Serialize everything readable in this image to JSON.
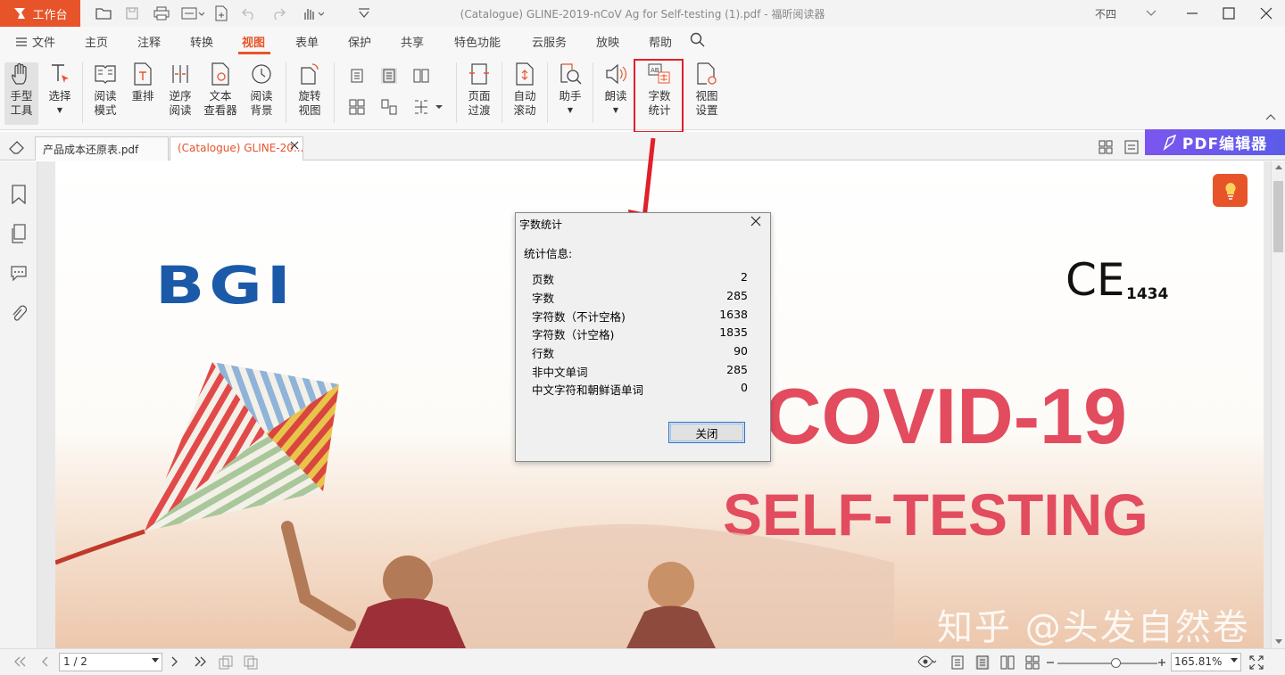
{
  "titlebar": {
    "workbench_label": "工作台",
    "doc_title": "(Catalogue) GLINE-2019-nCoV Ag for Self-testing (1).pdf - 福昕阅读器",
    "user_name": "不四"
  },
  "menu": {
    "file_label": "文件",
    "items": [
      "主页",
      "注释",
      "转换",
      "视图",
      "表单",
      "保护",
      "共享",
      "特色功能",
      "云服务",
      "放映",
      "帮助"
    ],
    "active": "视图"
  },
  "ribbon": {
    "hand": [
      "手型",
      "工具"
    ],
    "select": "选择",
    "read_mode": [
      "阅读",
      "模式"
    ],
    "reflow": "重排",
    "reverse_read": [
      "逆序",
      "阅读"
    ],
    "text_viewer": [
      "文本",
      "查看器"
    ],
    "read_bg": [
      "阅读",
      "背景"
    ],
    "rotate_view": [
      "旋转",
      "视图"
    ],
    "page_transition": [
      "页面",
      "过渡"
    ],
    "auto_scroll": [
      "自动",
      "滚动"
    ],
    "assistant": "助手",
    "read_aloud": "朗读",
    "word_count": [
      "字数",
      "统计"
    ],
    "view_settings": [
      "视图",
      "设置"
    ]
  },
  "tabs": [
    {
      "label": "产品成本还原表.pdf"
    },
    {
      "label": "(Catalogue) GLINE-20..."
    }
  ],
  "pdf_editor_label": "PDF编辑器",
  "document": {
    "logo_text": "BGI",
    "ce_mark": "CE",
    "ce_number": "1434",
    "headline1": "COVID-19",
    "headline2": "SELF-TESTING",
    "watermark": "知乎 @头发自然卷"
  },
  "dialog": {
    "title": "字数统计",
    "heading": "统计信息:",
    "rows": [
      {
        "label": "页数",
        "value": "2"
      },
      {
        "label": "字数",
        "value": "285"
      },
      {
        "label": "字符数（不计空格)",
        "value": "1638"
      },
      {
        "label": "字符数（计空格)",
        "value": "1835"
      },
      {
        "label": "行数",
        "value": "90"
      },
      {
        "label": "非中文单词",
        "value": "285"
      },
      {
        "label": "中文字符和朝鲜语单词",
        "value": "0"
      }
    ],
    "close_label": "关闭"
  },
  "statusbar": {
    "page": "1 / 2",
    "zoom": "165.81%"
  },
  "colors": {
    "accent": "#e8542a",
    "headline": "#e24c5e",
    "logo_blue": "#1b5aa8",
    "highlight_box": "#e0202a",
    "pdf_editor_purple": "#6b58ec"
  }
}
